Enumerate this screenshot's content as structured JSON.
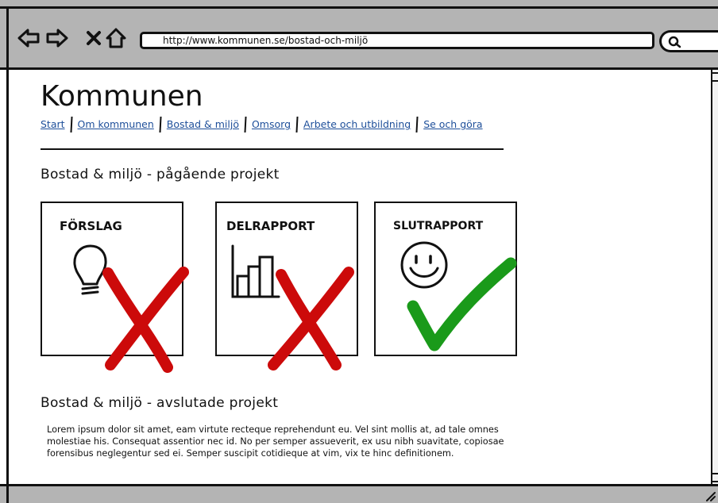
{
  "browser": {
    "url": "http://www.kommunen.se/bostad-och-miljö"
  },
  "page": {
    "site_title": "Kommunen",
    "nav": [
      {
        "label": "Start"
      },
      {
        "label": "Om kommunen"
      },
      {
        "label": "Bostad & miljö"
      },
      {
        "label": "Omsorg"
      },
      {
        "label": "Arbete och utbildning"
      },
      {
        "label": "Se och göra"
      }
    ],
    "ongoing_heading": "Bostad & miljö - pågående projekt",
    "cards": [
      {
        "title": "FÖRSLAG",
        "icon": "lightbulb-icon",
        "status": "not-done",
        "status_color": "#cc0a0a"
      },
      {
        "title": "DELRAPPORT",
        "icon": "bar-chart-icon",
        "status": "not-done",
        "status_color": "#cc0a0a"
      },
      {
        "title": "SLUTRAPPORT",
        "icon": "smiley-icon",
        "status": "done",
        "status_color": "#1a9a1a"
      }
    ],
    "finished_heading": "Bostad & miljö - avslutade projekt",
    "finished_text": "Lorem ipsum dolor sit amet, eam virtute recteque reprehendunt eu. Vel sint mollis at, ad tale omnes molestiae his. Consequat assentior nec id. No per semper assueverit, ex usu nibh suavitate, copiosae forensibus neglegentur sed ei. Semper suscipit cotidieque at vim, vix te hinc definitionem."
  },
  "colors": {
    "chrome": "#b4b4b4",
    "link": "#1e4f9a",
    "cross": "#cc0a0a",
    "check": "#1a9a1a"
  }
}
